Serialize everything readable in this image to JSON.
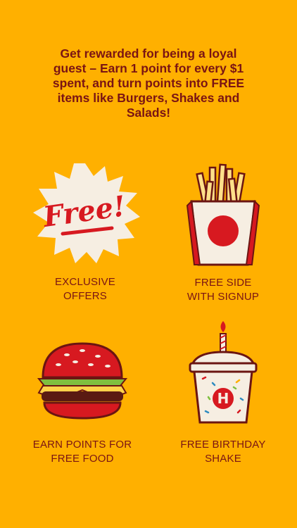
{
  "intro": {
    "lines": [
      "Get rewarded for being a loyal",
      "guest – Earn 1 point for every $1",
      "spent, and turn points into FREE",
      "items like Burgers, Shakes and",
      "Salads!"
    ]
  },
  "features": [
    {
      "icon": "free-burst-icon",
      "label_lines": [
        "EXCLUSIVE",
        "OFFERS"
      ],
      "art_text": "Free!"
    },
    {
      "icon": "fries-icon",
      "label_lines": [
        "FREE SIDE",
        "WITH SIGNUP"
      ]
    },
    {
      "icon": "burger-icon",
      "label_lines": [
        "EARN POINTS FOR",
        "FREE FOOD"
      ]
    },
    {
      "icon": "birthday-shake-icon",
      "label_lines": [
        "FREE BIRTHDAY",
        "SHAKE"
      ],
      "art_text": "H"
    }
  ],
  "colors": {
    "background": "#FFB000",
    "text": "#7A1414",
    "accent_red": "#D71920",
    "cream": "#F6EEE2"
  }
}
